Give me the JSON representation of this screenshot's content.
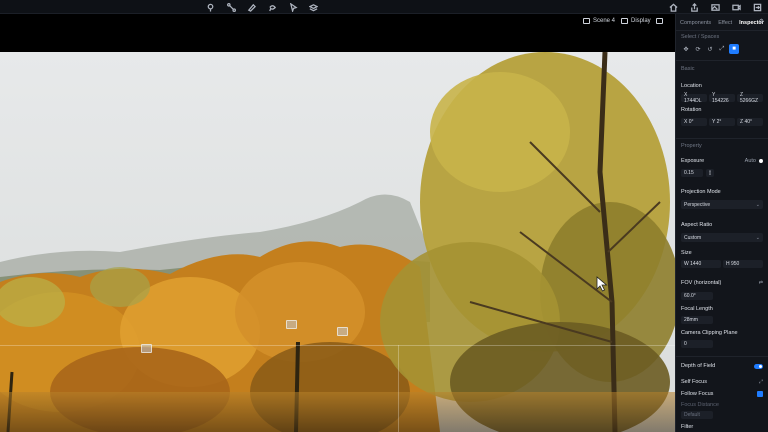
{
  "toolbar": {
    "tools": [
      {
        "name": "pin-icon"
      },
      {
        "name": "path-icon"
      },
      {
        "name": "brush-icon"
      },
      {
        "name": "lasso-icon"
      },
      {
        "name": "pointer-icon"
      },
      {
        "name": "layers-icon"
      }
    ],
    "right_icons": [
      {
        "name": "home-icon"
      },
      {
        "name": "share-icon"
      },
      {
        "name": "image-icon"
      },
      {
        "name": "video-icon"
      },
      {
        "name": "export-icon"
      }
    ]
  },
  "viewport": {
    "scene_label": "Scene 4",
    "display_label": "Display"
  },
  "panel": {
    "tabs": [
      "Components",
      "Effect",
      "Inspector"
    ],
    "active_tab": "Inspector",
    "select_spaces": "Select / Spaces",
    "section_basic": "Basic",
    "location_label": "Location",
    "location": {
      "x": "X 1744DL",
      "y": "Y 154226",
      "z": "Z 5266GZ"
    },
    "rotation_label": "Rotation",
    "rotation": {
      "x": "X 0°",
      "y": "Y 2°",
      "z": "Z 40°"
    },
    "section_property": "Property",
    "exposure_label": "Exposure",
    "exposure_mode": "Auto",
    "exposure_value": "0.15",
    "projection_label": "Projection Mode",
    "projection_value": "Perspective",
    "aspect_label": "Aspect Ratio",
    "aspect_value": "Custom",
    "size_label": "Size",
    "size_w": "W 1440",
    "size_h": "H 950",
    "fov_label": "FOV (horizontal)",
    "fov_value": "60.0°",
    "focal_label": "Focal Length",
    "focal_value": "28mm",
    "clip_label": "Camera Clipping Plane",
    "clip_value": "0",
    "dof_label": "Depth of Field",
    "self_focus_label": "Self Focus",
    "follow_focus_label": "Follow Focus",
    "focus_distance_label": "Focus Distance",
    "focus_distance_value": "Default",
    "filter_label": "Filter"
  },
  "colors": {
    "accent": "#1f7cff",
    "panel_bg": "#12151b",
    "toolbar_bg": "#0e1116"
  }
}
